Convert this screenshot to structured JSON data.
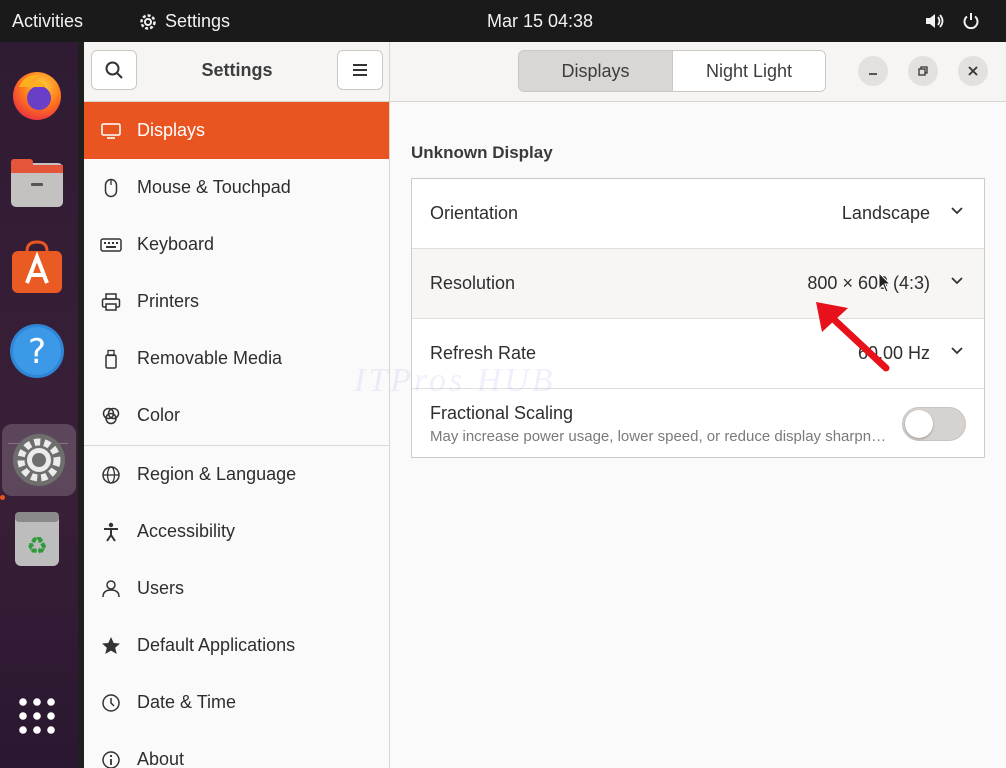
{
  "topbar": {
    "activities": "Activities",
    "app_name": "Settings",
    "clock": "Mar 15  04:38"
  },
  "dock": {
    "items": [
      "firefox-icon",
      "files-icon",
      "software-icon",
      "help-icon",
      "settings-icon",
      "trash-icon",
      "app-grid-icon"
    ]
  },
  "sidebar": {
    "title": "Settings",
    "items": [
      {
        "label": "Displays",
        "icon": "display-icon"
      },
      {
        "label": "Mouse & Touchpad",
        "icon": "mouse-icon"
      },
      {
        "label": "Keyboard",
        "icon": "keyboard-icon"
      },
      {
        "label": "Printers",
        "icon": "printer-icon"
      },
      {
        "label": "Removable Media",
        "icon": "removable-media-icon"
      },
      {
        "label": "Color",
        "icon": "color-icon"
      },
      {
        "label": "Region & Language",
        "icon": "globe-icon"
      },
      {
        "label": "Accessibility",
        "icon": "accessibility-icon"
      },
      {
        "label": "Users",
        "icon": "users-icon"
      },
      {
        "label": "Default Applications",
        "icon": "star-icon"
      },
      {
        "label": "Date & Time",
        "icon": "clock-icon"
      },
      {
        "label": "About",
        "icon": "info-icon"
      }
    ]
  },
  "header": {
    "tabs": [
      {
        "label": "Displays",
        "selected": true
      },
      {
        "label": "Night Light",
        "selected": false
      }
    ]
  },
  "main": {
    "section_title": "Unknown Display",
    "rows": {
      "orientation": {
        "label": "Orientation",
        "value": "Landscape"
      },
      "resolution": {
        "label": "Resolution",
        "value": "800 × 600 (4:3)"
      },
      "refresh": {
        "label": "Refresh Rate",
        "value": "60.00 Hz"
      },
      "scaling": {
        "label": "Fractional Scaling",
        "subtitle": "May increase power usage, lower speed, or reduce display sharpness.",
        "enabled": false
      }
    }
  },
  "watermark": "ITPros HUB",
  "colors": {
    "accent": "#e95420",
    "annotation_arrow": "#e8101a"
  }
}
